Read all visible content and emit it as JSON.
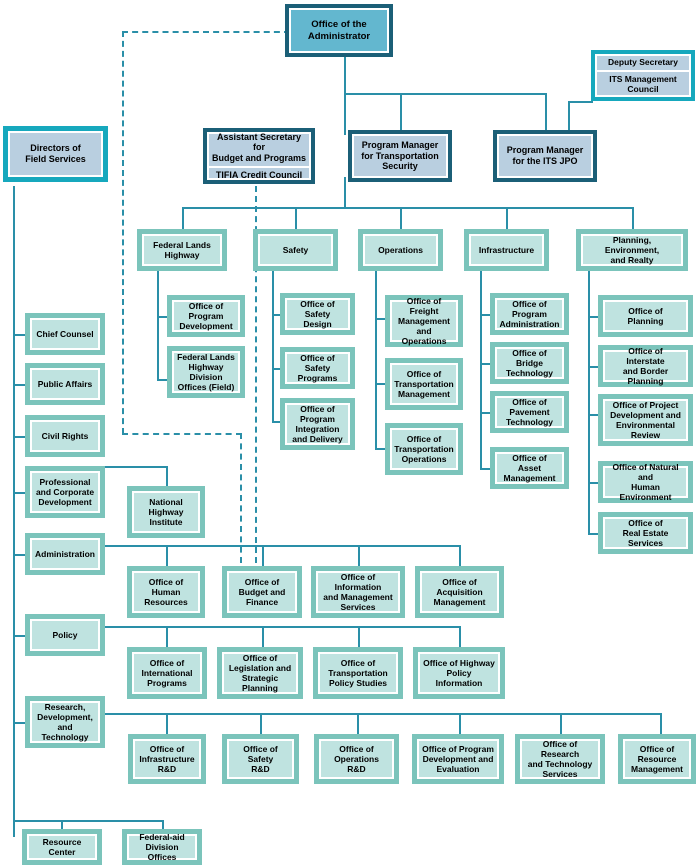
{
  "chart": {
    "title": "Federal Highway Administration Organization Chart",
    "colors": {
      "line": "#2a8fa8",
      "teal_frame": "#7bc4bb",
      "teal_fill": "#bfe3e0",
      "navy_frame": "#1b5f77",
      "navy_fill": "#63b7cf",
      "pale_blue_fill": "#b9cfe0",
      "cyan_frame": "#16a8bd"
    }
  },
  "top": {
    "administrator": "Office of the\nAdministrator",
    "administrator_l1": "Office of the",
    "administrator_l2": "Administrator",
    "deputy_secretary_l1": "Deputy Secretary",
    "deputy_secretary_l2": "ITS Management",
    "deputy_secretary_l3": "Council"
  },
  "tier2": {
    "directors_field_services_l1": "Directors of",
    "directors_field_services_l2": "Field Services",
    "assistant_secretary_l1": "Assistant Secretary for",
    "assistant_secretary_l2": "Budget and Programs",
    "tifia_credit_council": "TIFIA Credit Council",
    "pm_transportation_security_l1": "Program Manager",
    "pm_transportation_security_l2": "for Transportation",
    "pm_transportation_security_l3": "Security",
    "pm_its_jpo_l1": "Program Manager",
    "pm_its_jpo_l2": "for the ITS JPO"
  },
  "divisions": {
    "federal_lands_highway_l1": "Federal Lands",
    "federal_lands_highway_l2": "Highway",
    "safety": "Safety",
    "operations": "Operations",
    "infrastructure": "Infrastructure",
    "planning_l1": "Planning, Environment,",
    "planning_l2": "and Realty"
  },
  "federal_lands_offices": [
    {
      "l1": "Office of Program",
      "l2": "Development",
      "l3": ""
    },
    {
      "l1": "Federal Lands",
      "l2": "Highway Division",
      "l3": "Offices (Field)"
    }
  ],
  "safety_offices": [
    {
      "l1": "Office of",
      "l2": "Safety Design",
      "l3": ""
    },
    {
      "l1": "Office of",
      "l2": "Safety Programs",
      "l3": ""
    },
    {
      "l1": "Office of Program",
      "l2": "Integration",
      "l3": "and Delivery"
    }
  ],
  "operations_offices": [
    {
      "l1": "Office of Freight",
      "l2": "Management",
      "l3": "and Operations"
    },
    {
      "l1": "Office of",
      "l2": "Transportation",
      "l3": "Management"
    },
    {
      "l1": "Office of",
      "l2": "Transportation",
      "l3": "Operations"
    }
  ],
  "infrastructure_offices": [
    {
      "l1": "Office of Program",
      "l2": "Administration",
      "l3": ""
    },
    {
      "l1": "Office of Bridge",
      "l2": "Technology",
      "l3": ""
    },
    {
      "l1": "Office of Pavement",
      "l2": "Technology",
      "l3": ""
    },
    {
      "l1": "Office of Asset",
      "l2": "Management",
      "l3": ""
    }
  ],
  "planning_offices": [
    {
      "l1": "Office of",
      "l2": "Planning",
      "l3": ""
    },
    {
      "l1": "Office of Interstate",
      "l2": "and Border Planning",
      "l3": ""
    },
    {
      "l1": "Office of Project",
      "l2": "Development and",
      "l3": "Environmental Review"
    },
    {
      "l1": "Office of Natural and",
      "l2": "Human Environment",
      "l3": ""
    },
    {
      "l1": "Office of",
      "l2": "Real Estate Services",
      "l3": ""
    }
  ],
  "staff_offices": [
    {
      "l1": "Chief Counsel",
      "l2": "",
      "l3": ""
    },
    {
      "l1": "Public Affairs",
      "l2": "",
      "l3": ""
    },
    {
      "l1": "Civil Rights",
      "l2": "",
      "l3": ""
    },
    {
      "l1": "Professional",
      "l2": "and Corporate",
      "l3": "Development"
    },
    {
      "l1": "Administration",
      "l2": "",
      "l3": ""
    },
    {
      "l1": "Policy",
      "l2": "",
      "l3": ""
    },
    {
      "l1": "Research,",
      "l2": "Development,",
      "l3": "and Technology"
    }
  ],
  "national_highway_institute": {
    "l1": "National",
    "l2": "Highway",
    "l3": "Institute"
  },
  "administration_offices": [
    {
      "l1": "Office of",
      "l2": "Human",
      "l3": "Resources"
    },
    {
      "l1": "Office of",
      "l2": "Budget and",
      "l3": "Finance"
    },
    {
      "l1": "Office of Information",
      "l2": "and Management",
      "l3": "Services"
    },
    {
      "l1": "Office of",
      "l2": "Acquisition",
      "l3": "Management"
    }
  ],
  "policy_offices": [
    {
      "l1": "Office of",
      "l2": "International",
      "l3": "Programs"
    },
    {
      "l1": "Office of",
      "l2": "Legislation and",
      "l3": "Strategic Planning"
    },
    {
      "l1": "Office of",
      "l2": "Transportation",
      "l3": "Policy Studies"
    },
    {
      "l1": "Office of Highway",
      "l2": "Policy Information",
      "l3": ""
    }
  ],
  "rdt_offices": [
    {
      "l1": "Office of",
      "l2": "Infrastructure",
      "l3": "R&D"
    },
    {
      "l1": "Office of",
      "l2": "Safety",
      "l3": "R&D"
    },
    {
      "l1": "Office of",
      "l2": "Operations",
      "l3": "R&D"
    },
    {
      "l1": "Office of Program",
      "l2": "Development and",
      "l3": "Evaluation"
    },
    {
      "l1": "Office of Research",
      "l2": "and Technology",
      "l3": "Services"
    },
    {
      "l1": "Office of",
      "l2": "Resource",
      "l3": "Management"
    }
  ],
  "bottom_offices": [
    {
      "l1": "Resource Center",
      "l2": "",
      "l3": ""
    },
    {
      "l1": "Federal-aid",
      "l2": "Division Offices",
      "l3": ""
    }
  ]
}
